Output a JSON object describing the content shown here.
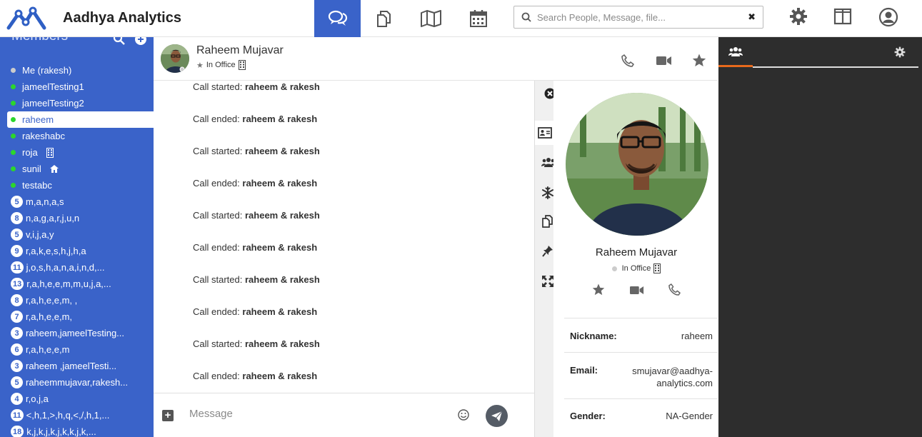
{
  "app": {
    "brand": "Aadhya Analytics"
  },
  "search": {
    "placeholder": "Search People, Message, file...",
    "clear_icon": "✖"
  },
  "sidebar": {
    "title": "Members",
    "members": [
      {
        "label": "Me (rakesh)",
        "status": "gray"
      },
      {
        "label": "jameelTesting1",
        "status": "green"
      },
      {
        "label": "jameelTesting2",
        "status": "green"
      },
      {
        "label": "raheem",
        "status": "green",
        "selected": true
      },
      {
        "label": "rakeshabc",
        "status": "green"
      },
      {
        "label": "roja",
        "status": "green",
        "icon": "building-icon"
      },
      {
        "label": "sunil",
        "status": "green",
        "icon": "home-icon"
      },
      {
        "label": "testabc",
        "status": "green"
      },
      {
        "label": "m,a,n,a,s",
        "badge": "5"
      },
      {
        "label": "n,a,g,a,r,j,u,n",
        "badge": "8"
      },
      {
        "label": "v,i,j,a,y",
        "badge": "5"
      },
      {
        "label": "r,a,k,e,s,h,j,h,a",
        "badge": "9"
      },
      {
        "label": "j,o,s,h,a,n,a,i,n,d,...",
        "badge": "11"
      },
      {
        "label": "r,a,h,e,e,m,m,u,j,a,...",
        "badge": "13"
      },
      {
        "label": "r,a,h,e,e,m, ,",
        "badge": "8"
      },
      {
        "label": "r,a,h,e,e,m,",
        "badge": "7"
      },
      {
        "label": "raheem,jameelTesting...",
        "badge": "3"
      },
      {
        "label": "r,a,h,e,e,m",
        "badge": "6"
      },
      {
        "label": "raheem ,jameelTesti...",
        "badge": "3"
      },
      {
        "label": "raheemmujavar,rakesh...",
        "badge": "5"
      },
      {
        "label": "r,o,j,a",
        "badge": "4"
      },
      {
        "label": "<,h,1,>,h,q,<,/,h,1,...",
        "badge": "11"
      },
      {
        "label": "k,j,k,j,k,j,k,k,j,k,...",
        "badge": "18"
      }
    ]
  },
  "chat": {
    "name": "Raheem Mujavar",
    "status": "In Office",
    "messages": [
      {
        "prefix": "Call started: ",
        "bold": "raheem & rakesh"
      },
      {
        "prefix": "Call ended: ",
        "bold": "raheem & rakesh"
      },
      {
        "prefix": "Call started: ",
        "bold": "raheem & rakesh"
      },
      {
        "prefix": "Call ended: ",
        "bold": "raheem & rakesh"
      },
      {
        "prefix": "Call started: ",
        "bold": "raheem & rakesh"
      },
      {
        "prefix": "Call ended: ",
        "bold": "raheem & rakesh"
      },
      {
        "prefix": "Call started: ",
        "bold": "raheem & rakesh"
      },
      {
        "prefix": "Call ended: ",
        "bold": "raheem & rakesh"
      },
      {
        "prefix": "Call started: ",
        "bold": "raheem & rakesh"
      },
      {
        "prefix": "Call ended: ",
        "bold": "raheem & rakesh"
      }
    ],
    "composer_placeholder": "Message"
  },
  "profile": {
    "name": "Raheem  Mujavar",
    "status": "In Office",
    "nickname_label": "Nickname:",
    "nickname": "raheem",
    "email_label": "Email:",
    "email_line1": "smujavar@aadhya-",
    "email_line2": "analytics.com",
    "gender_label": "Gender:",
    "gender": "NA-Gender"
  },
  "colors": {
    "primary": "#3a63c9",
    "online": "#2cd62c",
    "accent": "#e86a1c",
    "dark_panel": "#2d2d2d"
  }
}
